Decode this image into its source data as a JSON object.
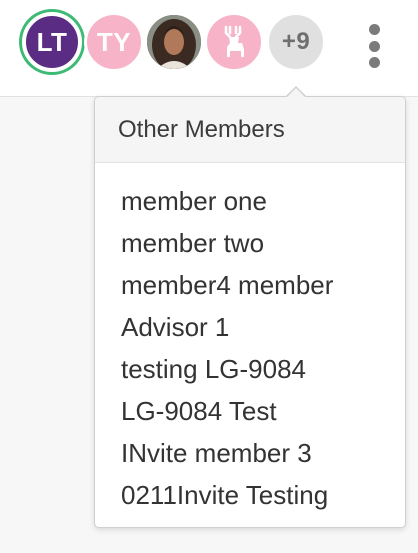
{
  "avatars": [
    {
      "initials": "LT",
      "color": "#5b2c83",
      "ring": "#3dbb75"
    },
    {
      "initials": "TY",
      "color": "#f7b3c8"
    },
    {
      "initials": "",
      "type": "photo"
    },
    {
      "icon": "deer-icon",
      "color": "#f7b3c8"
    },
    {
      "label": "+9",
      "color": "#e0e0e0"
    }
  ],
  "menu_icon": "kebab-menu-icon",
  "popover": {
    "title": "Other Members",
    "members": [
      "member one",
      "member two",
      "member4 member",
      "Advisor 1",
      "testing LG-9084",
      "LG-9084 Test",
      "INvite member 3",
      "0211Invite Testing"
    ]
  }
}
